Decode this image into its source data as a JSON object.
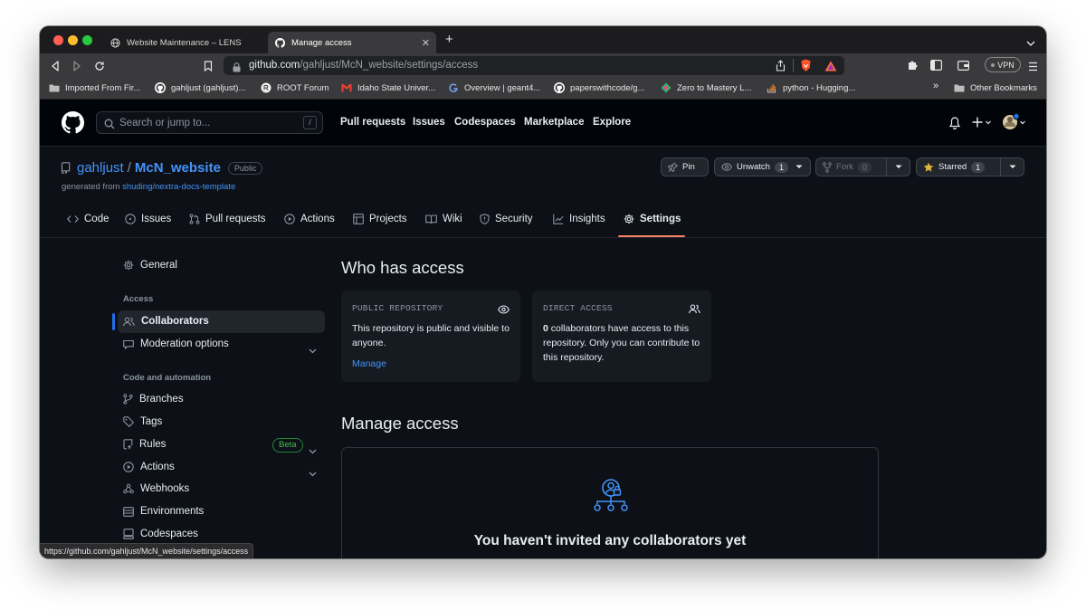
{
  "browser": {
    "tabs": [
      {
        "title": "Website Maintenance – LENS",
        "icon": "globe-icon",
        "active": false
      },
      {
        "title": "Manage access",
        "icon": "github-icon",
        "active": true
      }
    ],
    "new_tab": "+",
    "url_domain": "github.com",
    "url_path": "/gahljust/McN_website/settings/access",
    "vpn_label": "VPN",
    "bookmarks": [
      {
        "label": "Imported From Fir...",
        "icon": "folder-icon"
      },
      {
        "label": "gahljust (gahljust)...",
        "icon": "github-icon"
      },
      {
        "label": "ROOT Forum",
        "icon": "root-icon"
      },
      {
        "label": "Idaho State Univer...",
        "icon": "gmail-icon"
      },
      {
        "label": "Overview | geant4...",
        "icon": "geant4-icon"
      },
      {
        "label": "paperswithcode/g...",
        "icon": "github-icon"
      },
      {
        "label": "Zero to Mastery L...",
        "icon": "ztm-icon"
      },
      {
        "label": "python - Hugging...",
        "icon": "stackoverflow-icon"
      }
    ],
    "bookmarks_more": "»",
    "other_bookmarks": "Other Bookmarks",
    "status_url": "https://github.com/gahljust/McN_website/settings/access"
  },
  "header": {
    "search_placeholder": "Search or jump to...",
    "search_shortcut": "/",
    "nav": [
      "Pull requests",
      "Issues",
      "Codespaces",
      "Marketplace",
      "Explore"
    ]
  },
  "repo": {
    "owner": "gahljust",
    "separator": "/",
    "name": "McN_website",
    "visibility": "Public",
    "generated_from_label": "generated from",
    "generated_from_repo": "shuding/nextra-docs-template",
    "pin_label": "Pin",
    "unwatch_label": "Unwatch",
    "unwatch_count": "1",
    "fork_label": "Fork",
    "fork_count": "0",
    "starred_label": "Starred",
    "starred_count": "1",
    "tabs": [
      "Code",
      "Issues",
      "Pull requests",
      "Actions",
      "Projects",
      "Wiki",
      "Security",
      "Insights",
      "Settings"
    ],
    "active_tab": "Settings"
  },
  "sidebar": {
    "general": "General",
    "access_heading": "Access",
    "collaborators": "Collaborators",
    "moderation": "Moderation options",
    "code_heading": "Code and automation",
    "branches": "Branches",
    "tags": "Tags",
    "rules": "Rules",
    "rules_badge": "Beta",
    "actions": "Actions",
    "webhooks": "Webhooks",
    "environments": "Environments",
    "codespaces": "Codespaces"
  },
  "main": {
    "who_title": "Who has access",
    "public_card": {
      "label": "PUBLIC REPOSITORY",
      "text": "This repository is public and visible to anyone.",
      "link": "Manage"
    },
    "direct_card": {
      "label": "DIRECT ACCESS",
      "count": "0",
      "text": " collaborators have access to this repository. Only you can contribute to this repository."
    },
    "manage_title": "Manage access",
    "empty_state": "You haven't invited any collaborators yet"
  },
  "colors": {
    "accent_link": "#4493f8",
    "active_underline": "#f78166",
    "sidebar_active": "#1f6feb",
    "beta_green": "#3fb950",
    "bg": "#0d1117"
  }
}
